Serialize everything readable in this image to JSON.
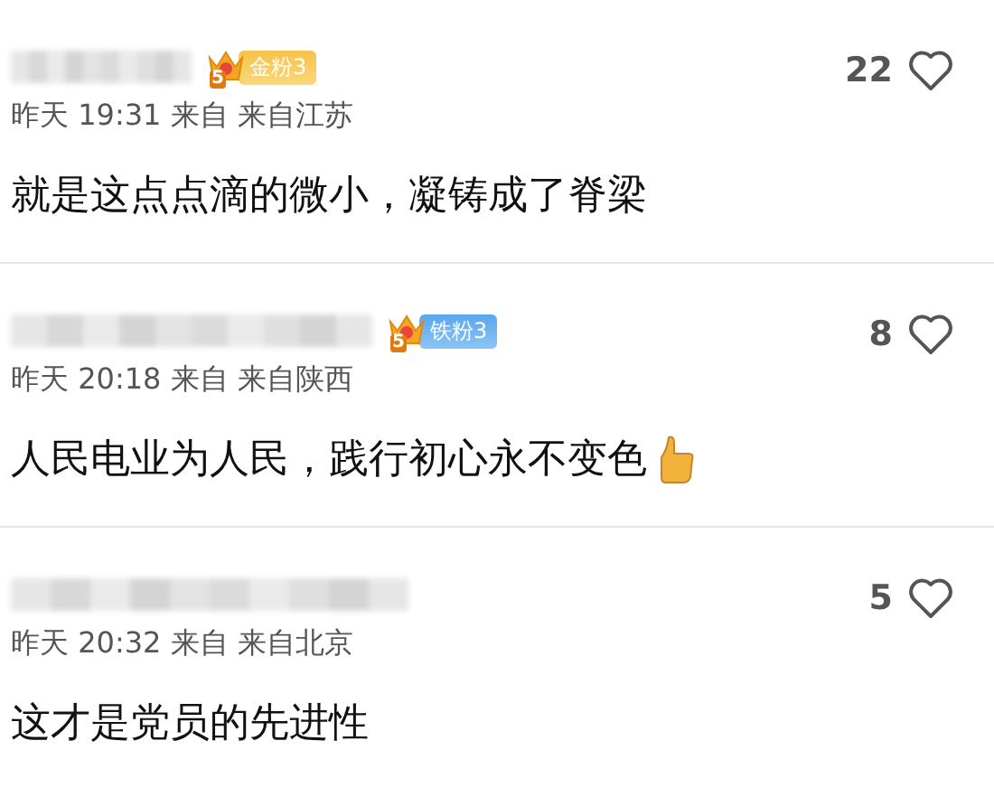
{
  "comments": [
    {
      "badge": {
        "kind": "gold",
        "level": "5",
        "label": "金粉3"
      },
      "meta": "昨天 19:31 来自 来自江苏",
      "text": "就是这点点滴的微小，凝铸成了脊梁",
      "thumb_icon": false,
      "likes": "22"
    },
    {
      "badge": {
        "kind": "iron",
        "level": "5",
        "label": "铁粉3"
      },
      "meta": "昨天 20:18 来自 来自陕西",
      "text": "人民电业为人民，践行初心永不变色",
      "thumb_icon": true,
      "likes": "8"
    },
    {
      "meta": "昨天 20:32 来自 来自北京",
      "text": "这才是党员的先进性",
      "thumb_icon": false,
      "likes": "5"
    }
  ]
}
